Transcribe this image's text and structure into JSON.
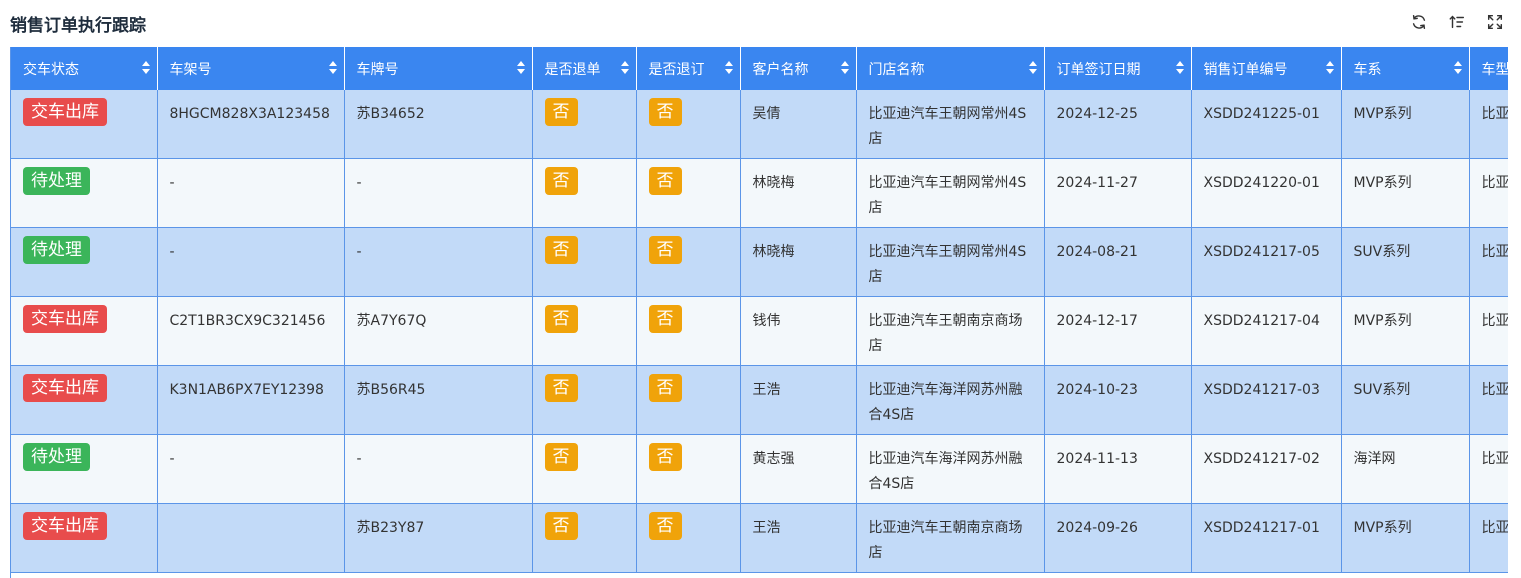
{
  "page_title": "销售订单执行跟踪",
  "toolbar": {
    "icons": [
      "refresh-icon",
      "column-settings-icon",
      "fullscreen-icon"
    ]
  },
  "colors": {
    "header": "#3a86f0",
    "row_odd": "#c2daf8",
    "row_even": "#f3f8fb",
    "tag_red": "#e84c4c",
    "tag_green": "#3bb55a",
    "tag_orange": "#f0a30a"
  },
  "table": {
    "headers": [
      "交车状态",
      "车架号",
      "车牌号",
      "是否退单",
      "是否退订",
      "客户名称",
      "门店名称",
      "订单签订日期",
      "销售订单编号",
      "车系",
      "车型"
    ],
    "rows": [
      {
        "status": "交车出库",
        "status_color": "red",
        "vin": "8HGCM828X3A123458",
        "plate": "苏B34652",
        "refund": "否",
        "cancel": "否",
        "customer": "吴倩",
        "store": "比亚迪汽车王朝网常州4S店",
        "date": "2024-12-25",
        "order_no": "XSDD241225-01",
        "series": "MVP系列",
        "model": "比亚"
      },
      {
        "status": "待处理",
        "status_color": "green",
        "vin": "-",
        "plate": "-",
        "refund": "否",
        "cancel": "否",
        "customer": "林晓梅",
        "store": "比亚迪汽车王朝网常州4S店",
        "date": "2024-11-27",
        "order_no": "XSDD241220-01",
        "series": "MVP系列",
        "model": "比亚"
      },
      {
        "status": "待处理",
        "status_color": "green",
        "vin": "-",
        "plate": "-",
        "refund": "否",
        "cancel": "否",
        "customer": "林晓梅",
        "store": "比亚迪汽车王朝网常州4S店",
        "date": "2024-08-21",
        "order_no": "XSDD241217-05",
        "series": "SUV系列",
        "model": "比亚"
      },
      {
        "status": "交车出库",
        "status_color": "red",
        "vin": "C2T1BR3CX9C321456",
        "plate": "苏A7Y67Q",
        "refund": "否",
        "cancel": "否",
        "customer": "钱伟",
        "store": "比亚迪汽车王朝南京商场店",
        "date": "2024-12-17",
        "order_no": "XSDD241217-04",
        "series": "MVP系列",
        "model": "比亚"
      },
      {
        "status": "交车出库",
        "status_color": "red",
        "vin": "K3N1AB6PX7EY12398",
        "plate": "苏B56R45",
        "refund": "否",
        "cancel": "否",
        "customer": "王浩",
        "store": "比亚迪汽车海洋网苏州融合4S店",
        "date": "2024-10-23",
        "order_no": "XSDD241217-03",
        "series": "SUV系列",
        "model": "比亚"
      },
      {
        "status": "待处理",
        "status_color": "green",
        "vin": "-",
        "plate": "-",
        "refund": "否",
        "cancel": "否",
        "customer": "黄志强",
        "store": "比亚迪汽车海洋网苏州融合4S店",
        "date": "2024-11-13",
        "order_no": "XSDD241217-02",
        "series": "海洋网",
        "model": "比亚"
      },
      {
        "status": "交车出库",
        "status_color": "red",
        "vin": "",
        "plate": "苏B23Y87",
        "refund": "否",
        "cancel": "否",
        "customer": "王浩",
        "store": "比亚迪汽车王朝南京商场店",
        "date": "2024-09-26",
        "order_no": "XSDD241217-01",
        "series": "MVP系列",
        "model": "比亚"
      }
    ]
  }
}
